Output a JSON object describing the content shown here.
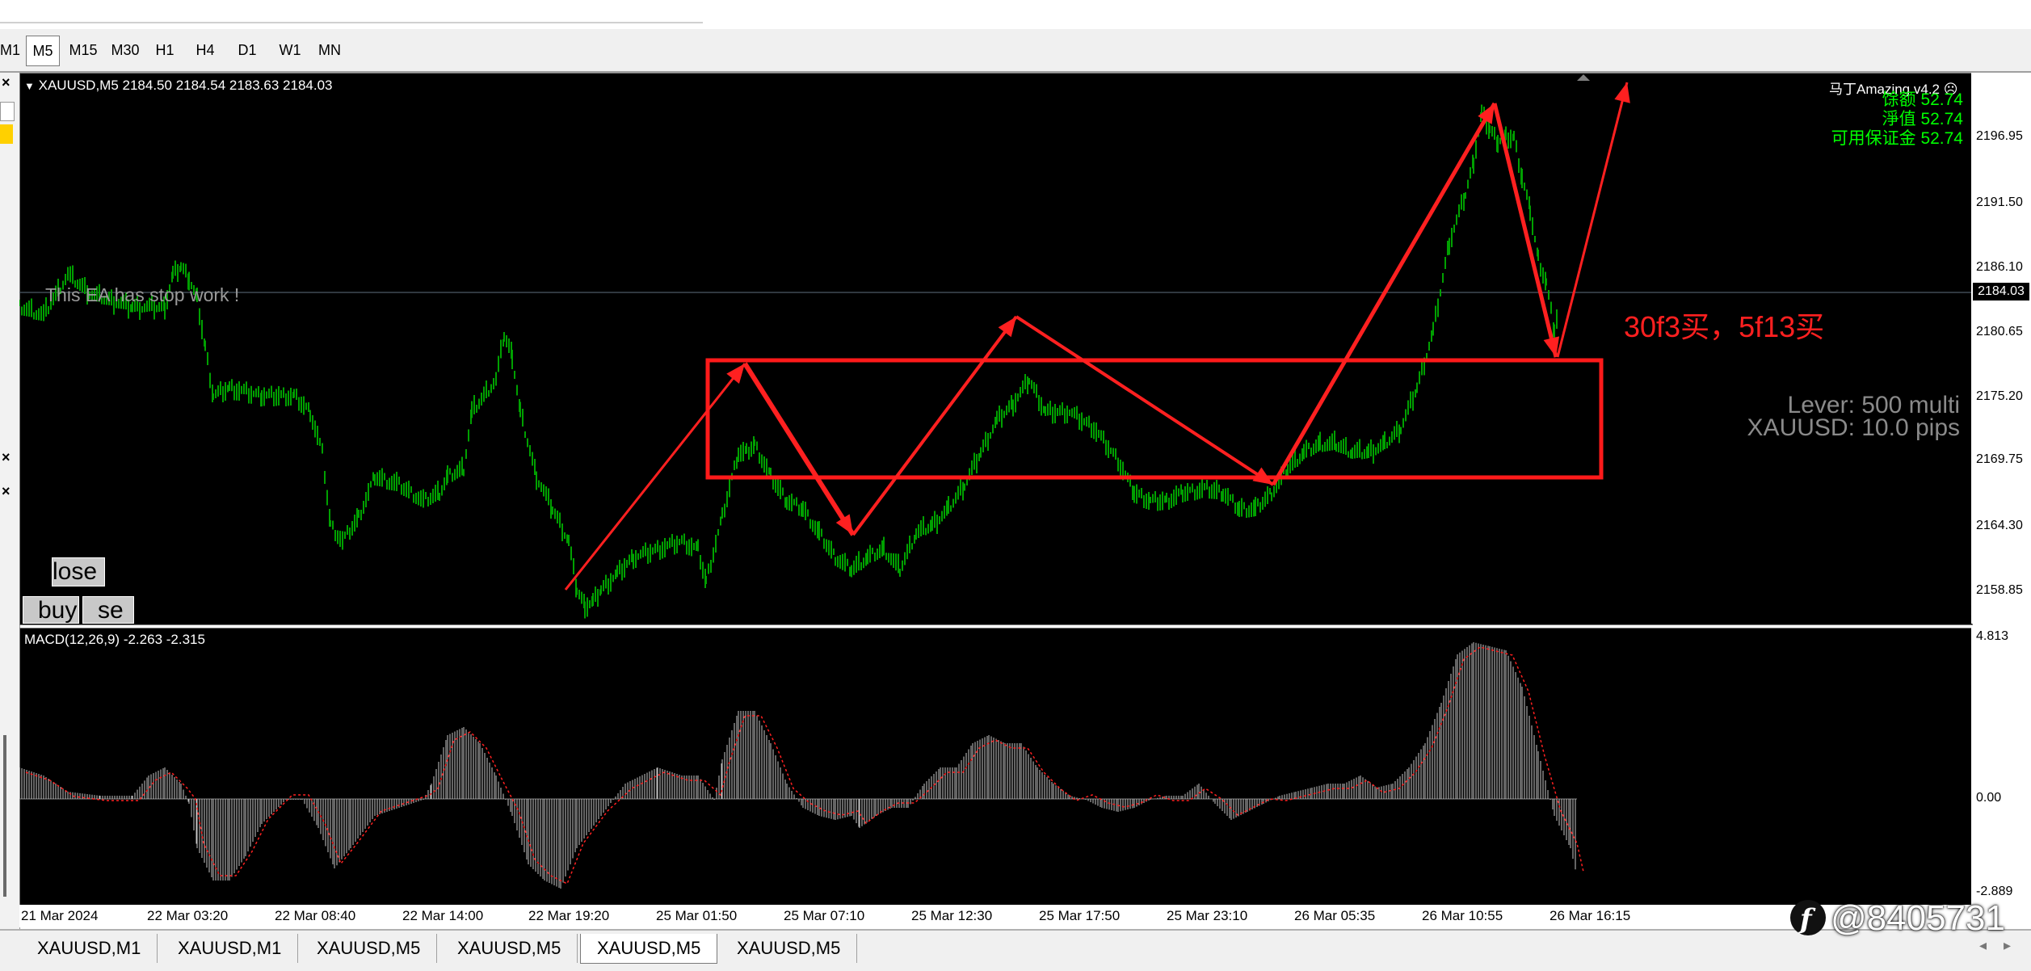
{
  "toolbar": {
    "timeframes": [
      "M1",
      "M5",
      "M15",
      "M30",
      "H1",
      "H4",
      "D1",
      "W1",
      "MN"
    ],
    "active_timeframe": "M5"
  },
  "chart": {
    "symbol_info": "XAUUSD,M5  2184.50 2184.54 2183.63 2184.03",
    "ea_status": "This EA has stop work !",
    "ea_name": "马丁Amazing v4.2",
    "balance_label": "馀额",
    "balance_value": "52.74",
    "equity_label": "淨值",
    "equity_value": "52.74",
    "free_margin_label": "可用保证金",
    "free_margin_value": "52.74",
    "lever_text": "Lever: 500 multi",
    "pips_text": "XAUUSD: 10.0 pips",
    "annotation": "30f3买，5f13买",
    "close_button": "lose",
    "buy_button": "buy",
    "sell_button": "se",
    "price_ticks": [
      "2196.95",
      "2191.50",
      "2186.10",
      "2180.65",
      "2175.20",
      "2169.75",
      "2164.30",
      "2158.85"
    ],
    "current_price": "2184.03",
    "colors": {
      "candle": "#00a000",
      "annotation": "#ff2020",
      "macd_hist": "#c8c8c8",
      "macd_signal": "#ff2020",
      "info": "#00ff00"
    }
  },
  "macd": {
    "label": "MACD(12,26,9) -2.263 -2.315",
    "ticks": [
      "4.813",
      "0.00",
      "-2.889"
    ]
  },
  "time_axis": [
    "21 Mar 2024",
    "22 Mar 03:20",
    "22 Mar 08:40",
    "22 Mar 14:00",
    "22 Mar 19:20",
    "25 Mar 01:50",
    "25 Mar 07:10",
    "25 Mar 12:30",
    "25 Mar 17:50",
    "25 Mar 23:10",
    "26 Mar 05:35",
    "26 Mar 10:55",
    "26 Mar 16:15"
  ],
  "tabs": [
    "XAUUSD,M1",
    "XAUUSD,M1",
    "XAUUSD,M5",
    "XAUUSD,M5",
    "XAUUSD,M5",
    "XAUUSD,M5"
  ],
  "active_tab": 4,
  "watermark": "@8405731"
}
